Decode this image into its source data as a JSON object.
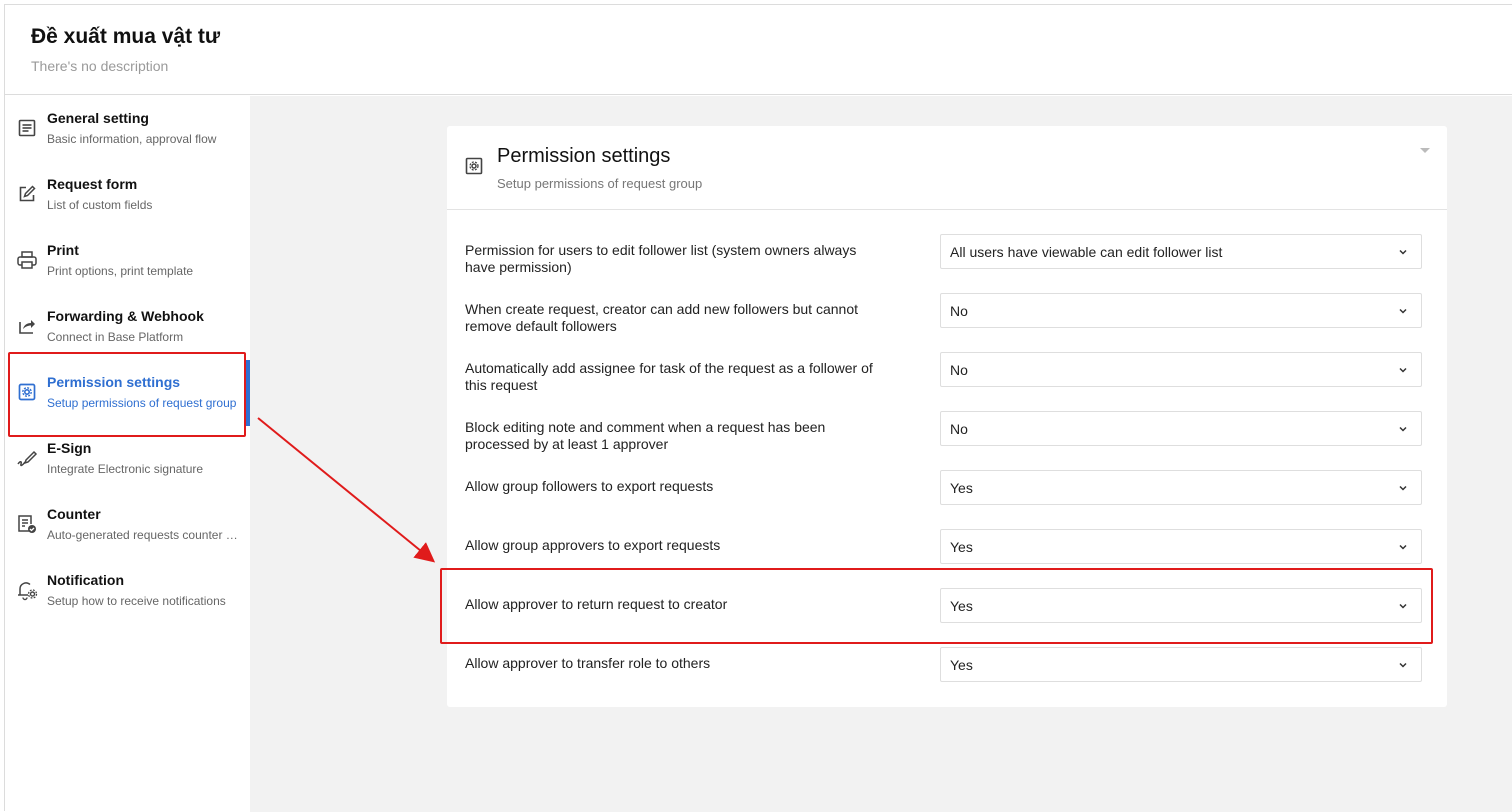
{
  "header": {
    "title": "Đề xuất mua vật tư",
    "description": "There's no description"
  },
  "sidebar": {
    "items": [
      {
        "title": "General setting",
        "subtitle": "Basic information, approval flow",
        "icon": "document-icon"
      },
      {
        "title": "Request form",
        "subtitle": "List of custom fields",
        "icon": "edit-icon"
      },
      {
        "title": "Print",
        "subtitle": "Print options, print template",
        "icon": "printer-icon"
      },
      {
        "title": "Forwarding & Webhook",
        "subtitle": "Connect in Base Platform",
        "icon": "share-icon"
      },
      {
        "title": "Permission settings",
        "subtitle": "Setup permissions of request group",
        "icon": "gear-icon"
      },
      {
        "title": "E-Sign",
        "subtitle": "Integrate Electronic signature",
        "icon": "signature-icon"
      },
      {
        "title": "Counter",
        "subtitle": "Auto-generated requests counter configuration",
        "icon": "counter-icon"
      },
      {
        "title": "Notification",
        "subtitle": "Setup how to receive notifications",
        "icon": "bell-gear-icon"
      }
    ],
    "active_index": 4
  },
  "permissions": {
    "title": "Permission settings",
    "subtitle": "Setup permissions of request group",
    "settings": [
      {
        "label": "Permission for users to edit follower list (system owners always have permission)",
        "value": "All users have viewable can edit follower list"
      },
      {
        "label": "When create request, creator can add new followers but cannot remove default followers",
        "value": "No"
      },
      {
        "label": "Automatically add assignee for task of the request as a follower of this request",
        "value": "No"
      },
      {
        "label": "Block editing note and comment when a request has been processed by at least 1 approver",
        "value": "No"
      },
      {
        "label": "Allow group followers to export requests",
        "value": "Yes"
      },
      {
        "label": "Allow group approvers to export requests",
        "value": "Yes"
      },
      {
        "label": "Allow approver to return request to creator",
        "value": "Yes"
      },
      {
        "label": "Allow approver to transfer role to others",
        "value": "Yes"
      }
    ]
  },
  "colors": {
    "accent": "#2f6fd1",
    "annotation": "#e01b1b",
    "background": "#f2f2f2"
  }
}
